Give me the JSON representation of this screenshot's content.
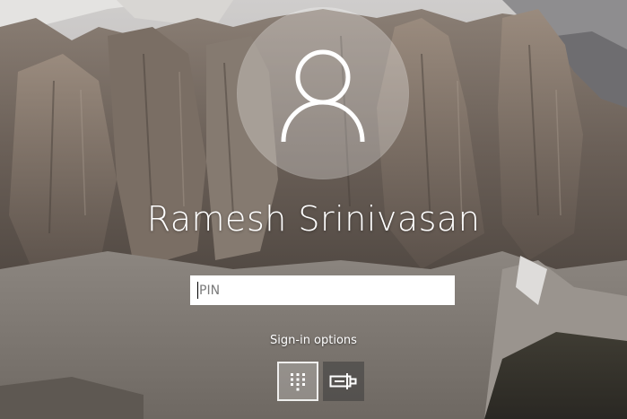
{
  "lock_screen": {
    "user_name": "Ramesh Srinivasan",
    "pin_placeholder": "PIN",
    "pin_value": "",
    "signin_options_label": "Sign-in options",
    "options": [
      {
        "name": "PIN",
        "icon": "keypad-icon",
        "selected": true
      },
      {
        "name": "Security key",
        "icon": "security-key-icon",
        "selected": false
      }
    ]
  },
  "colors": {
    "text": "#ffffff",
    "input_bg": "#ffffff",
    "avatar_bg": "rgba(255,255,255,0.28)"
  },
  "icons": {
    "avatar": "user-avatar-icon"
  }
}
